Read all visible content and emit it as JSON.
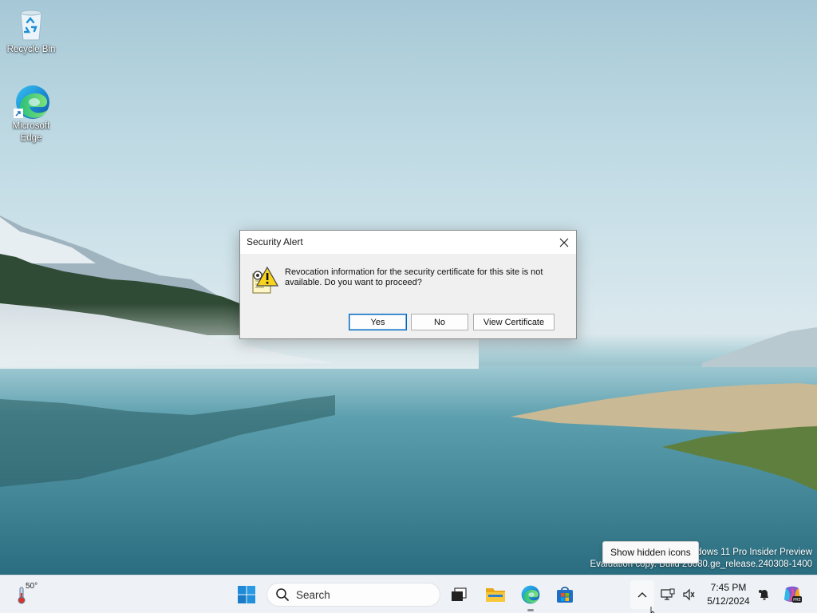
{
  "desktop": {
    "icons": [
      {
        "label": "Recycle Bin",
        "icon": "recycle-bin-icon"
      },
      {
        "label": "Microsoft Edge",
        "icon": "edge-icon"
      }
    ]
  },
  "dialog": {
    "title": "Security Alert",
    "message": "Revocation information for the security certificate for this site is not available. Do you want to proceed?",
    "buttons": {
      "yes": "Yes",
      "no": "No",
      "view": "View Certificate"
    },
    "close_icon": "close-icon",
    "message_icon": "security-warning-icon"
  },
  "watermark": {
    "line1": "Windows 11 Pro Insider Preview",
    "line2": "Evaluation copy. Build 26080.ge_release.240308-1400"
  },
  "tooltip": {
    "text": "Show hidden icons"
  },
  "taskbar": {
    "weather": {
      "temp": "50°"
    },
    "search": {
      "placeholder": "Search"
    },
    "clock": {
      "time": "7:45 PM",
      "date": "5/12/2024"
    },
    "apps": [
      "start-icon",
      "task-view-icon",
      "file-explorer-icon",
      "edge-icon",
      "microsoft-store-icon"
    ],
    "tray": [
      "chevron-up-icon",
      "network-icon",
      "volume-icon",
      "notification-icon",
      "copilot-icon"
    ]
  },
  "colors": {
    "accent": "#0067c0",
    "taskbar": "#eef2f6",
    "dialog": "#f0f0f0"
  }
}
